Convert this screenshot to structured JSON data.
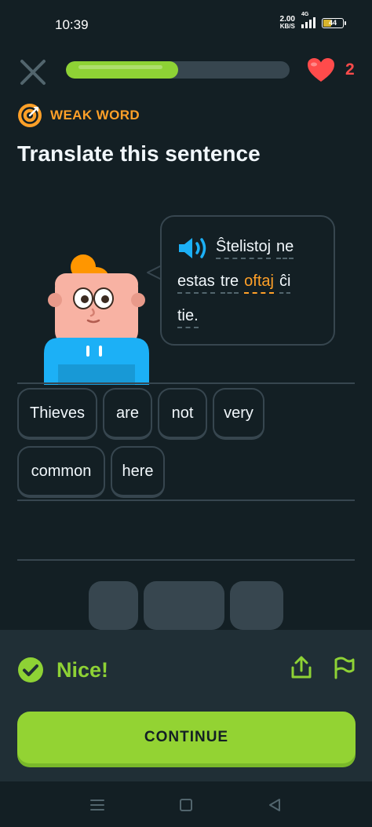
{
  "status_bar": {
    "time": "10:39",
    "net_speed_value": "2.00",
    "net_speed_unit": "KB/S",
    "network_type": "4G",
    "battery": "44"
  },
  "progress": {
    "fraction": 0.5
  },
  "hearts": {
    "count": "2"
  },
  "tag": {
    "label": "WEAK WORD"
  },
  "heading": "Translate this sentence",
  "prompt": {
    "lines": [
      [
        "Ŝtelistoj",
        "ne"
      ],
      [
        "estas",
        "tre",
        "oftaj",
        "ĉi"
      ],
      [
        "tie."
      ]
    ],
    "highlighted_word": "oftaj"
  },
  "answer": {
    "words": [
      "Thieves",
      "are",
      "not",
      "very",
      "common",
      "here"
    ]
  },
  "feedback": {
    "message": "Nice!",
    "continue_label": "CONTINUE"
  },
  "colors": {
    "background": "#131f24",
    "accent_green": "#8ed235",
    "warning_orange": "#ffa028",
    "heart_red": "#ff4b4b",
    "speaker_blue": "#1cb0f6"
  }
}
